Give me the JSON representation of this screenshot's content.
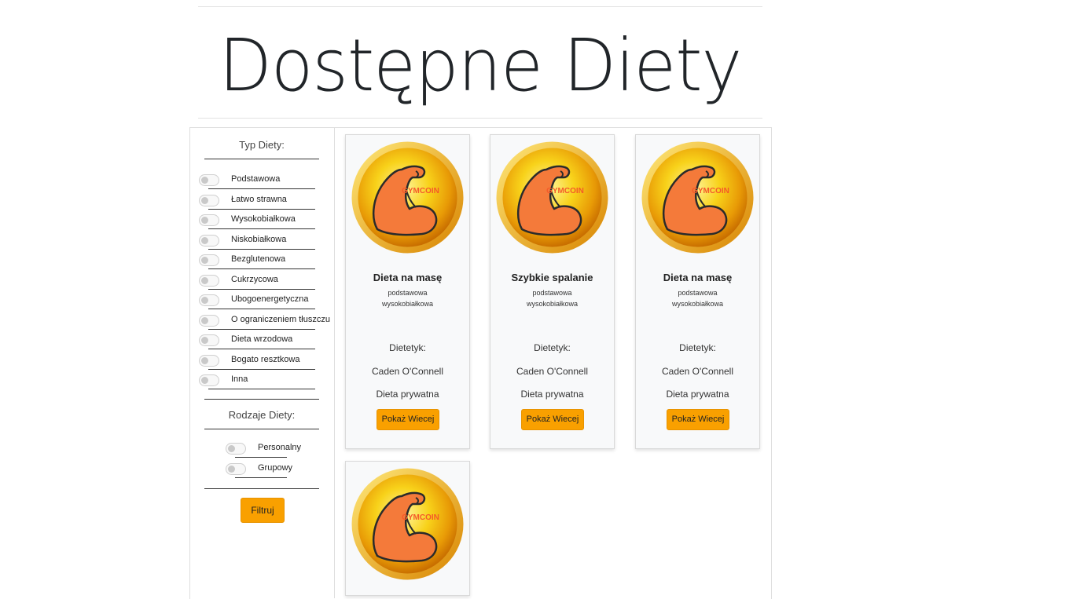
{
  "page": {
    "title": "Dostępne Diety"
  },
  "sidebar": {
    "diet_type_title": "Typ Diety:",
    "diet_types": [
      {
        "label": "Podstawowa"
      },
      {
        "label": "Łatwo strawna"
      },
      {
        "label": "Wysokobiałkowa"
      },
      {
        "label": "Niskobiałkowa"
      },
      {
        "label": "Bezglutenowa"
      },
      {
        "label": "Cukrzycowa"
      },
      {
        "label": "Ubogoenergetyczna"
      },
      {
        "label": "O ograniczeniem tłuszczu"
      },
      {
        "label": "Dieta wrzodowa"
      },
      {
        "label": "Bogato resztkowa"
      },
      {
        "label": "Inna"
      }
    ],
    "diet_kind_title": "Rodzaje Diety:",
    "diet_kinds": [
      {
        "label": "Personalny"
      },
      {
        "label": "Grupowy"
      }
    ],
    "filter_button": "Filtruj"
  },
  "cards": [
    {
      "name": "Dieta na masę",
      "types": [
        "podstawowa",
        "wysokobiałkowa"
      ],
      "dietitian_label": "Dietetyk:",
      "dietitian": "Caden O'Connell",
      "privacy": "Dieta prywatna",
      "button": "Pokaż Wiecej",
      "logo_text": "GYMCOIN"
    },
    {
      "name": "Szybkie spalanie",
      "types": [
        "podstawowa",
        "wysokobiałkowa"
      ],
      "dietitian_label": "Dietetyk:",
      "dietitian": "Caden O'Connell",
      "privacy": "Dieta prywatna",
      "button": "Pokaż Wiecej",
      "logo_text": "GYMCOIN"
    },
    {
      "name": "Dieta na masę",
      "types": [
        "podstawowa",
        "wysokobiałkowa"
      ],
      "dietitian_label": "Dietetyk:",
      "dietitian": "Caden O'Connell",
      "privacy": "Dieta prywatna",
      "button": "Pokaż Wiecej",
      "logo_text": "GYMCOIN"
    },
    {
      "logo_text": "GYMCOIN"
    }
  ],
  "colors": {
    "accent": "#f9a000",
    "card_bg": "#f8f9fa",
    "coin_gold": "#f5c400",
    "muscle": "#f47a3a"
  }
}
